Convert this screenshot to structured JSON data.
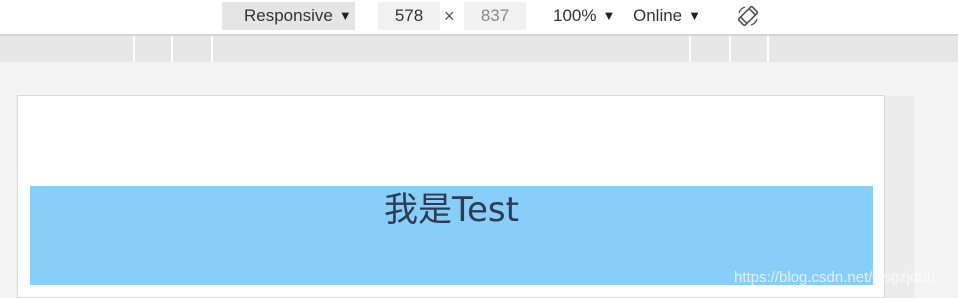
{
  "toolbar": {
    "device_label": "Responsive",
    "width_value": "578",
    "height_value": "837",
    "times_glyph": "×",
    "zoom_label": "100%",
    "throttle_label": "Online",
    "caret_glyph": "▼"
  },
  "viewport": {
    "heading_text": "我是Test",
    "box_color": "#87cefa"
  },
  "watermark": {
    "text": "https://blog.csdn.net/wsgzjdbb"
  }
}
